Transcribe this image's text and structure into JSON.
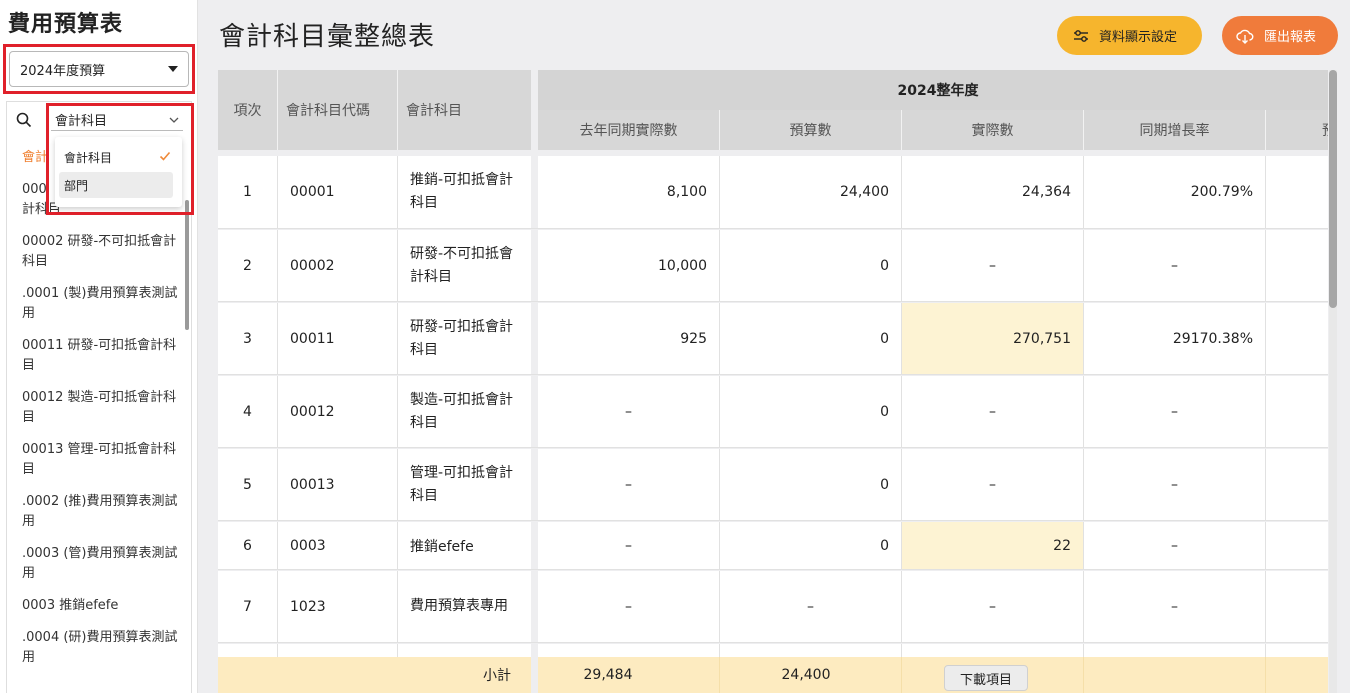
{
  "sidebar": {
    "app_title": "費用預算表",
    "budget_select": "2024年度預算",
    "scope_select": "會計科目",
    "dropdown_options": [
      "會計科目",
      "部門"
    ],
    "active_item": "會計",
    "items": [
      "000",
      "計科目",
      "00002 研發-不可扣抵會計科目",
      ".0001 (製)費用預算表測試用",
      "00011 研發-可扣抵會計科目",
      "00012 製造-可扣抵會計科目",
      "00013 管理-可扣抵會計科目",
      ".0002 (推)費用預算表測試用",
      ".0003 (管)費用預算表測試用",
      "0003 推銷efefe",
      ".0004 (研)費用預算表測試用"
    ]
  },
  "main": {
    "title": "會計科目彙整總表",
    "settings_button": "資料顯示設定",
    "export_button": "匯出報表",
    "year_header": "2024整年度",
    "columns": {
      "index": "項次",
      "code": "會計科目代碼",
      "name": "會計科目",
      "last_year": "去年同期實際數",
      "budget": "預算數",
      "actual": "實際數",
      "growth": "同期增長率",
      "next": "預"
    },
    "rows": [
      {
        "index": "1",
        "code": "00001",
        "name": "推銷-可扣抵會計科目",
        "last_year": "8,100",
        "budget": "24,400",
        "actual": "24,364",
        "growth": "200.79%"
      },
      {
        "index": "2",
        "code": "00002",
        "name": "研發-不可扣抵會計科目",
        "last_year": "10,000",
        "budget": "0",
        "actual": "–",
        "growth": "–"
      },
      {
        "index": "3",
        "code": "00011",
        "name": "研發-可扣抵會計科目",
        "last_year": "925",
        "budget": "0",
        "actual": "270,751",
        "growth": "29170.38%"
      },
      {
        "index": "4",
        "code": "00012",
        "name": "製造-可扣抵會計科目",
        "last_year": "–",
        "budget": "0",
        "actual": "–",
        "growth": "–"
      },
      {
        "index": "5",
        "code": "00013",
        "name": "管理-可扣抵會計科目",
        "last_year": "–",
        "budget": "0",
        "actual": "–",
        "growth": "–"
      },
      {
        "index": "6",
        "code": "0003",
        "name": "推銷efefe",
        "last_year": "–",
        "budget": "0",
        "actual": "22",
        "growth": "–"
      },
      {
        "index": "7",
        "code": "1023",
        "name": "費用預算表專用",
        "last_year": "–",
        "budget": "–",
        "actual": "–",
        "growth": "–"
      }
    ],
    "subtotal_label": "小計",
    "subtotal_last_year": "29,484",
    "subtotal_budget": "24,400",
    "download_button": "下載項目"
  },
  "colors": {
    "accent_yellow": "#f6b52d",
    "accent_orange": "#f07b3b",
    "highlight_cell": "#fdf3d3",
    "subtotal_bg": "#fdebc0",
    "annotation_red": "#e0202a"
  }
}
